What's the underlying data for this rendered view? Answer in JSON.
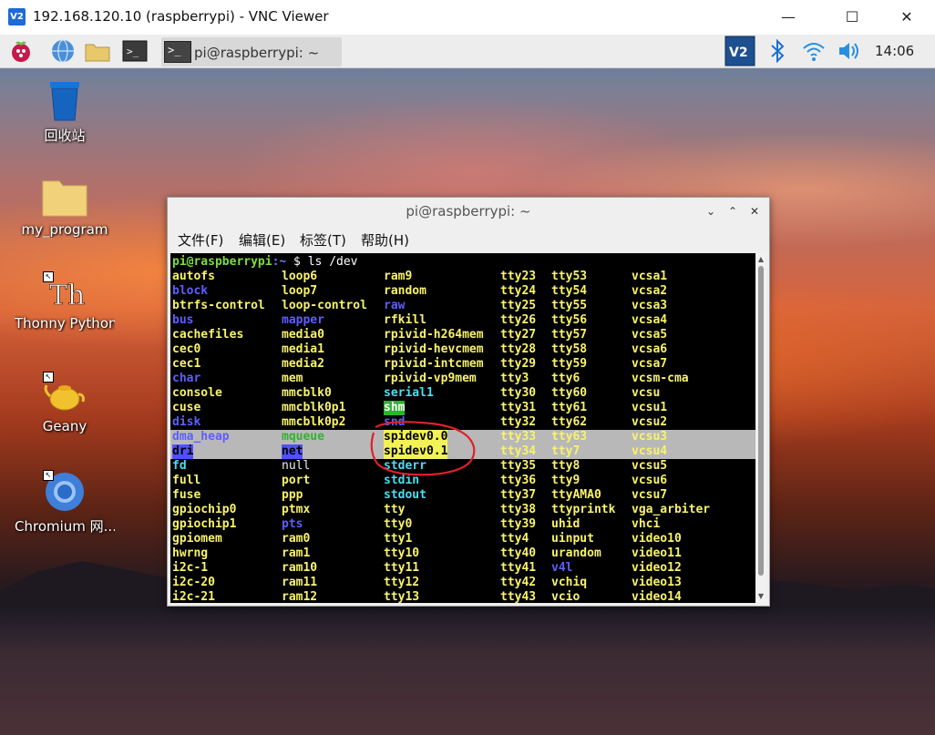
{
  "window": {
    "logo": "V2",
    "title": "192.168.120.10 (raspberrypi) - VNC Viewer",
    "minimize_glyph": "—",
    "maximize_glyph": "☐",
    "close_glyph": "✕"
  },
  "panel": {
    "task_label": "pi@raspberrypi: ~",
    "task_icon_text": ">_",
    "clock": "14:06",
    "icons": [
      "raspberry-menu-icon",
      "web-browser-icon",
      "file-manager-icon",
      "terminal-icon",
      "vnc-server-icon",
      "bluetooth-icon",
      "wifi-icon",
      "volume-icon"
    ]
  },
  "desktop_icons": {
    "trash": "回收站",
    "folder": "my_program",
    "thonny": "Thonny Python...",
    "geany": "Geany",
    "chromium": "Chromium 网..."
  },
  "terminal": {
    "title": "pi@raspberrypi: ~",
    "menus": [
      "文件(F)",
      "编辑(E)",
      "标签(T)",
      "帮助(H)"
    ],
    "prompt_user": "pi@raspberrypi",
    "prompt_path": ":~",
    "prompt_cmd": " $ ls /dev",
    "columns": [
      [
        {
          "t": "autofs",
          "c": "f"
        },
        {
          "t": "block",
          "c": "d"
        },
        {
          "t": "btrfs-control",
          "c": "f"
        },
        {
          "t": "bus",
          "c": "d"
        },
        {
          "t": "cachefiles",
          "c": "f"
        },
        {
          "t": "cec0",
          "c": "f"
        },
        {
          "t": "cec1",
          "c": "f"
        },
        {
          "t": "char",
          "c": "d"
        },
        {
          "t": "console",
          "c": "f"
        },
        {
          "t": "cuse",
          "c": "f"
        },
        {
          "t": "disk",
          "c": "d"
        },
        {
          "t": "dma_heap",
          "c": "d"
        },
        {
          "t": "dri",
          "c": "bg-blue"
        },
        {
          "t": "fd",
          "c": "l"
        },
        {
          "t": "full",
          "c": "f"
        },
        {
          "t": "fuse",
          "c": "f"
        },
        {
          "t": "gpiochip0",
          "c": "f"
        },
        {
          "t": "gpiochip1",
          "c": "f"
        },
        {
          "t": "gpiomem",
          "c": "f"
        },
        {
          "t": "hwrng",
          "c": "f"
        },
        {
          "t": "i2c-1",
          "c": "f"
        },
        {
          "t": "i2c-20",
          "c": "f"
        },
        {
          "t": "i2c-21",
          "c": "f"
        }
      ],
      [
        {
          "t": "loop6",
          "c": "f"
        },
        {
          "t": "loop7",
          "c": "f"
        },
        {
          "t": "loop-control",
          "c": "f"
        },
        {
          "t": "mapper",
          "c": "d"
        },
        {
          "t": "media0",
          "c": "f"
        },
        {
          "t": "media1",
          "c": "f"
        },
        {
          "t": "media2",
          "c": "f"
        },
        {
          "t": "mem",
          "c": "f"
        },
        {
          "t": "mmcblk0",
          "c": "f"
        },
        {
          "t": "mmcblk0p1",
          "c": "f"
        },
        {
          "t": "mmcblk0p2",
          "c": "f"
        },
        {
          "t": "mqueue",
          "c": "bg-greenfg"
        },
        {
          "t": "net",
          "c": "bg-blue"
        },
        {
          "t": "null",
          "c": "w"
        },
        {
          "t": "port",
          "c": "f"
        },
        {
          "t": "ppp",
          "c": "f"
        },
        {
          "t": "ptmx",
          "c": "f"
        },
        {
          "t": "pts",
          "c": "d"
        },
        {
          "t": "ram0",
          "c": "f"
        },
        {
          "t": "ram1",
          "c": "f"
        },
        {
          "t": "ram10",
          "c": "f"
        },
        {
          "t": "ram11",
          "c": "f"
        },
        {
          "t": "ram12",
          "c": "f"
        }
      ],
      [
        {
          "t": "ram9",
          "c": "f"
        },
        {
          "t": "random",
          "c": "f"
        },
        {
          "t": "raw",
          "c": "d"
        },
        {
          "t": "rfkill",
          "c": "f"
        },
        {
          "t": "rpivid-h264mem",
          "c": "f"
        },
        {
          "t": "rpivid-hevcmem",
          "c": "f"
        },
        {
          "t": "rpivid-intcmem",
          "c": "f"
        },
        {
          "t": "rpivid-vp9mem",
          "c": "f"
        },
        {
          "t": "serial1",
          "c": "l"
        },
        {
          "t": "shm",
          "c": "bg-green"
        },
        {
          "t": "snd",
          "c": "d"
        },
        {
          "t": "spidev0.0",
          "c": "bg-yellow"
        },
        {
          "t": "spidev0.1",
          "c": "bg-yellow"
        },
        {
          "t": "stderr",
          "c": "l"
        },
        {
          "t": "stdin",
          "c": "l"
        },
        {
          "t": "stdout",
          "c": "l"
        },
        {
          "t": "tty",
          "c": "f"
        },
        {
          "t": "tty0",
          "c": "f"
        },
        {
          "t": "tty1",
          "c": "f"
        },
        {
          "t": "tty10",
          "c": "f"
        },
        {
          "t": "tty11",
          "c": "f"
        },
        {
          "t": "tty12",
          "c": "f"
        },
        {
          "t": "tty13",
          "c": "f"
        }
      ],
      [
        {
          "t": "tty23",
          "c": "f"
        },
        {
          "t": "tty24",
          "c": "f"
        },
        {
          "t": "tty25",
          "c": "f"
        },
        {
          "t": "tty26",
          "c": "f"
        },
        {
          "t": "tty27",
          "c": "f"
        },
        {
          "t": "tty28",
          "c": "f"
        },
        {
          "t": "tty29",
          "c": "f"
        },
        {
          "t": "tty3",
          "c": "f"
        },
        {
          "t": "tty30",
          "c": "f"
        },
        {
          "t": "tty31",
          "c": "f"
        },
        {
          "t": "tty32",
          "c": "f"
        },
        {
          "t": "tty33",
          "c": "f"
        },
        {
          "t": "tty34",
          "c": "f"
        },
        {
          "t": "tty35",
          "c": "f"
        },
        {
          "t": "tty36",
          "c": "f"
        },
        {
          "t": "tty37",
          "c": "f"
        },
        {
          "t": "tty38",
          "c": "f"
        },
        {
          "t": "tty39",
          "c": "f"
        },
        {
          "t": "tty4",
          "c": "f"
        },
        {
          "t": "tty40",
          "c": "f"
        },
        {
          "t": "tty41",
          "c": "f"
        },
        {
          "t": "tty42",
          "c": "f"
        },
        {
          "t": "tty43",
          "c": "f"
        }
      ],
      [
        {
          "t": "tty53",
          "c": "f"
        },
        {
          "t": "tty54",
          "c": "f"
        },
        {
          "t": "tty55",
          "c": "f"
        },
        {
          "t": "tty56",
          "c": "f"
        },
        {
          "t": "tty57",
          "c": "f"
        },
        {
          "t": "tty58",
          "c": "f"
        },
        {
          "t": "tty59",
          "c": "f"
        },
        {
          "t": "tty6",
          "c": "f"
        },
        {
          "t": "tty60",
          "c": "f"
        },
        {
          "t": "tty61",
          "c": "f"
        },
        {
          "t": "tty62",
          "c": "f"
        },
        {
          "t": "tty63",
          "c": "f"
        },
        {
          "t": "tty7",
          "c": "f"
        },
        {
          "t": "tty8",
          "c": "f"
        },
        {
          "t": "tty9",
          "c": "f"
        },
        {
          "t": "ttyAMA0",
          "c": "f"
        },
        {
          "t": "ttyprintk",
          "c": "f"
        },
        {
          "t": "uhid",
          "c": "f"
        },
        {
          "t": "uinput",
          "c": "f"
        },
        {
          "t": "urandom",
          "c": "f"
        },
        {
          "t": "v4l",
          "c": "d"
        },
        {
          "t": "vchiq",
          "c": "f"
        },
        {
          "t": "vcio",
          "c": "f"
        }
      ],
      [
        {
          "t": "vcsa1",
          "c": "f"
        },
        {
          "t": "vcsa2",
          "c": "f"
        },
        {
          "t": "vcsa3",
          "c": "f"
        },
        {
          "t": "vcsa4",
          "c": "f"
        },
        {
          "t": "vcsa5",
          "c": "f"
        },
        {
          "t": "vcsa6",
          "c": "f"
        },
        {
          "t": "vcsa7",
          "c": "f"
        },
        {
          "t": "vcsm-cma",
          "c": "f"
        },
        {
          "t": "vcsu",
          "c": "f"
        },
        {
          "t": "vcsu1",
          "c": "f"
        },
        {
          "t": "vcsu2",
          "c": "f"
        },
        {
          "t": "vcsu3",
          "c": "f"
        },
        {
          "t": "vcsu4",
          "c": "f"
        },
        {
          "t": "vcsu5",
          "c": "f"
        },
        {
          "t": "vcsu6",
          "c": "f"
        },
        {
          "t": "vcsu7",
          "c": "f"
        },
        {
          "t": "vga_arbiter",
          "c": "f"
        },
        {
          "t": "vhci",
          "c": "f"
        },
        {
          "t": "video10",
          "c": "f"
        },
        {
          "t": "video11",
          "c": "f"
        },
        {
          "t": "video12",
          "c": "f"
        },
        {
          "t": "video13",
          "c": "f"
        },
        {
          "t": "video14",
          "c": "f"
        }
      ]
    ],
    "selected_rows": [
      11,
      12
    ]
  },
  "colors": {
    "file": "#f8f36b",
    "directory": "#5e5eff",
    "symlink": "#49dff0",
    "annotation": "#e0202a"
  }
}
